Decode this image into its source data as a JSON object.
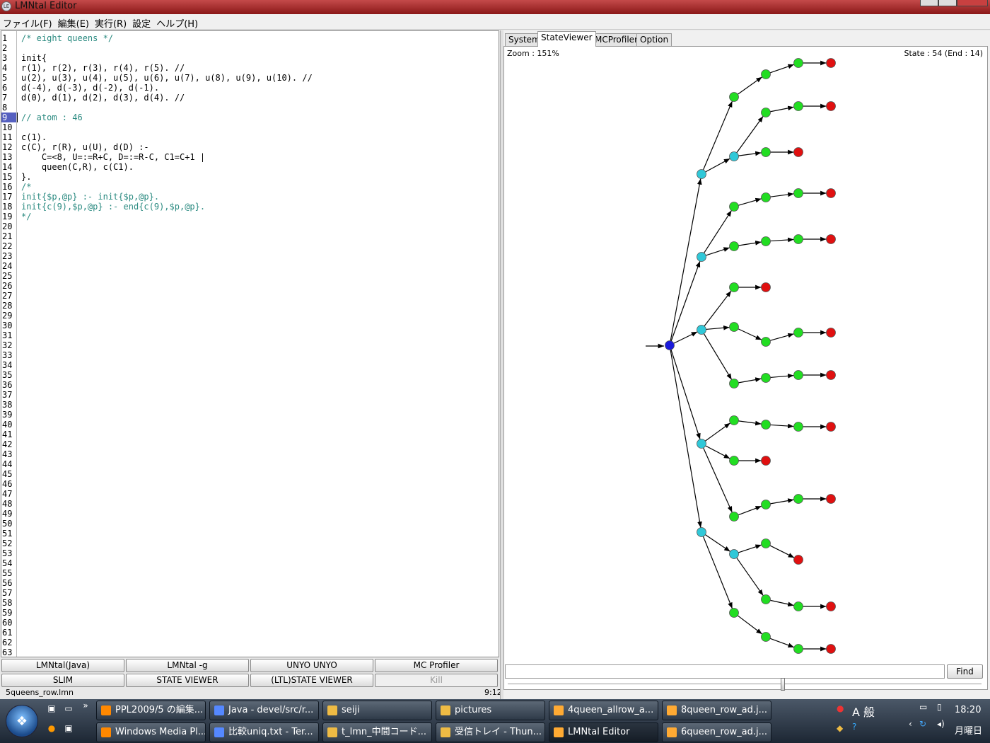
{
  "window": {
    "title": "LMNtal Editor",
    "icon_label": "LE"
  },
  "menu": [
    "ファイル(F)",
    "編集(E)",
    "実行(R)",
    "設定",
    "ヘルプ(H)"
  ],
  "editor": {
    "current_line": 9,
    "line_count": 63,
    "lines": [
      {
        "n": 1,
        "text": "/* eight queens */",
        "kind": "cmt"
      },
      {
        "n": 3,
        "text": "init{",
        "kind": "code"
      },
      {
        "n": 4,
        "text": "r(1), r(2), r(3), r(4), r(5). //",
        "kind": "code"
      },
      {
        "n": 5,
        "text": "u(2), u(3), u(4), u(5), u(6), u(7), u(8), u(9), u(10). //",
        "kind": "code"
      },
      {
        "n": 6,
        "text": "d(-4), d(-3), d(-2), d(-1).",
        "kind": "code"
      },
      {
        "n": 7,
        "text": "d(0), d(1), d(2), d(3), d(4). //",
        "kind": "code"
      },
      {
        "n": 9,
        "text": "// atom : 46",
        "kind": "cmt"
      },
      {
        "n": 11,
        "text": "c(1).",
        "kind": "code"
      },
      {
        "n": 12,
        "text": "c(C), r(R), u(U), d(D) :-",
        "kind": "code"
      },
      {
        "n": 13,
        "text": "    C=<8, U=:=R+C, D=:=R-C, C1=C+1 |",
        "kind": "code"
      },
      {
        "n": 14,
        "text": "    queen(C,R), c(C1).",
        "kind": "code"
      },
      {
        "n": 15,
        "text": "}.",
        "kind": "code"
      },
      {
        "n": 16,
        "text": "/*",
        "kind": "cmt"
      },
      {
        "n": 17,
        "text": "init{$p,@p} :- init{$p,@p}.",
        "kind": "cmt"
      },
      {
        "n": 18,
        "text": "init{c(9),$p,@p} :- end{c(9),$p,@p}.",
        "kind": "cmt"
      },
      {
        "n": 19,
        "text": "*/",
        "kind": "cmt"
      }
    ]
  },
  "buttons": {
    "row1": [
      "LMNtal(Java)",
      "LMNtal -g",
      "UNYO UNYO",
      "MC Profiler"
    ],
    "row2": [
      "SLIM",
      "STATE VIEWER",
      "(LTL)STATE VIEWER",
      "Kill"
    ]
  },
  "status": {
    "filename": "5queens_row.lmn",
    "position": "9:12"
  },
  "tabs": [
    "System",
    "StateViewer",
    "MCProfiler",
    "Option"
  ],
  "active_tab": "StateViewer",
  "viewer": {
    "zoom": "Zoom : 151%",
    "state": "State : 54 (End : 14)",
    "find_label": "Find",
    "colors": {
      "initial": "#1a1adc",
      "branch": "#30c8d8",
      "intermediate": "#22dd22",
      "final": "#e01010",
      "edge": "#000000"
    }
  },
  "taskbar": {
    "row1": [
      "PPL2009/5 の編集...",
      "Java - devel/src/r...",
      "seiji",
      "pictures",
      "4queen_allrow_a...",
      "8queen_row_ad.j..."
    ],
    "row2": [
      "Windows Media Pl...",
      "比較uniq.txt - Ter...",
      "t_lmn_中間コード...",
      "受信トレイ - Thun...",
      "LMNtal Editor",
      "6queen_row_ad.j..."
    ],
    "active": "LMNtal Editor",
    "clock": "18:20",
    "day": "月曜日",
    "ime": "A 般"
  }
}
